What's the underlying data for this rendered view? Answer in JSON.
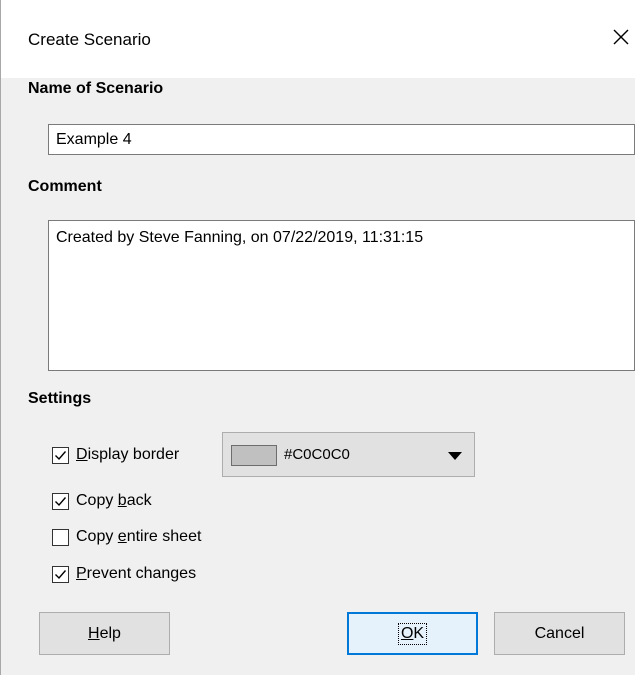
{
  "dialog": {
    "title": "Create Scenario",
    "close_icon": "close-icon"
  },
  "name_section": {
    "label": "Name of Scenario",
    "value": "Example 4"
  },
  "comment_section": {
    "label": "Comment",
    "value": "Created by Steve Fanning, on 07/22/2019, 11:31:15"
  },
  "settings": {
    "label": "Settings",
    "display_border": {
      "pre": "",
      "accel": "D",
      "post": "isplay border",
      "checked": true
    },
    "copy_back": {
      "pre": "Copy ",
      "accel": "b",
      "post": "ack",
      "checked": true
    },
    "copy_entire_sheet": {
      "pre": "Copy ",
      "accel": "e",
      "post": "ntire sheet",
      "checked": false
    },
    "prevent_changes": {
      "pre": "",
      "accel": "P",
      "post": "revent changes",
      "checked": true
    },
    "border_color": {
      "label": "#C0C0C0",
      "swatch": "#C0C0C0"
    }
  },
  "buttons": {
    "help": {
      "pre": "",
      "accel": "H",
      "post": "elp"
    },
    "ok": {
      "pre": "",
      "accel": "O",
      "post": "K"
    },
    "cancel": "Cancel"
  },
  "colors": {
    "dialog_bg": "#F0F0F0",
    "button_bg": "#E1E1E1",
    "default_button_border": "#0078D7",
    "default_button_bg": "#E5F1FB"
  }
}
